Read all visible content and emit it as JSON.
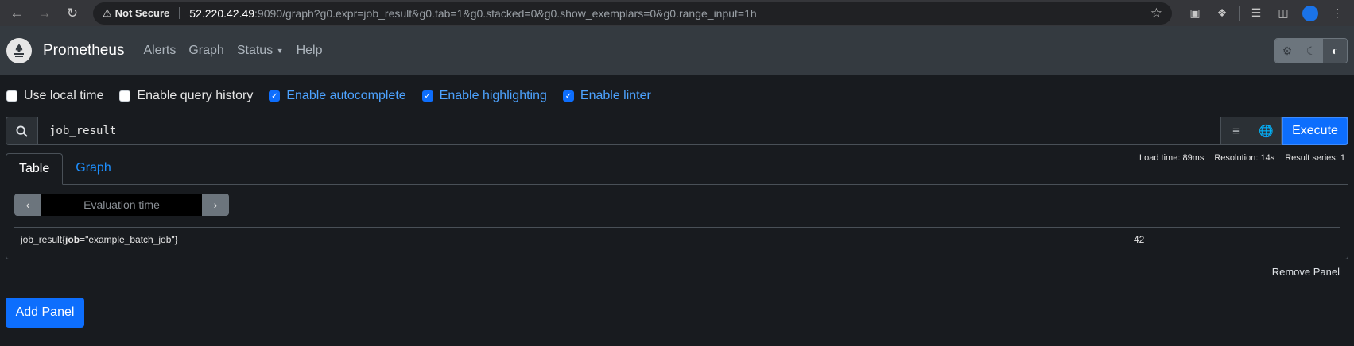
{
  "browser": {
    "security_label": "Not Secure",
    "url_host": "52.220.42.49",
    "url_rest": ":9090/graph?g0.expr=job_result&g0.tab=1&g0.stacked=0&g0.show_exemplars=0&g0.range_input=1h"
  },
  "navbar": {
    "brand": "Prometheus",
    "links": {
      "alerts": "Alerts",
      "graph": "Graph",
      "status": "Status",
      "help": "Help"
    },
    "theme_active": "auto"
  },
  "options": {
    "use_local_time": {
      "label": "Use local time",
      "checked": false
    },
    "query_history": {
      "label": "Enable query history",
      "checked": false
    },
    "autocomplete": {
      "label": "Enable autocomplete",
      "checked": true
    },
    "highlighting": {
      "label": "Enable highlighting",
      "checked": true
    },
    "linter": {
      "label": "Enable linter",
      "checked": true
    }
  },
  "expression": {
    "value": "job_result",
    "execute_label": "Execute"
  },
  "tabs": {
    "table": "Table",
    "graph": "Graph"
  },
  "stats": {
    "load_time": "Load time: 89ms",
    "resolution": "Resolution: 14s",
    "result_series": "Result series: 1"
  },
  "table": {
    "eval_placeholder": "Evaluation time",
    "rows": [
      {
        "metric": "job_result",
        "label_name": "job",
        "label_value": "\"example_batch_job\"",
        "value": "42"
      }
    ]
  },
  "panel": {
    "remove_label": "Remove Panel"
  },
  "add_panel_label": "Add Panel",
  "colors": {
    "accent": "#0d6efd",
    "link": "#1e90ff",
    "navbar": "#343a40",
    "background": "#181b1f"
  }
}
